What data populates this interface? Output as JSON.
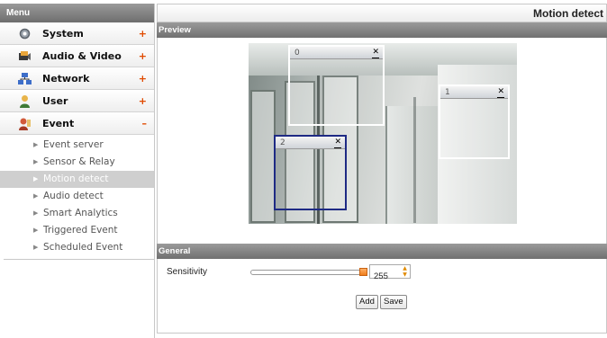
{
  "sidebar": {
    "header": "Menu",
    "items": [
      {
        "label": "System",
        "toggle": "+",
        "icon": "gear-icon"
      },
      {
        "label": "Audio & Video",
        "toggle": "+",
        "icon": "camera-icon"
      },
      {
        "label": "Network",
        "toggle": "+",
        "icon": "network-icon"
      },
      {
        "label": "User",
        "toggle": "+",
        "icon": "user-icon"
      },
      {
        "label": "Event",
        "toggle": "–",
        "icon": "event-icon"
      }
    ],
    "submenu": [
      {
        "label": "Event server",
        "active": false
      },
      {
        "label": "Sensor & Relay",
        "active": false
      },
      {
        "label": "Motion detect",
        "active": true
      },
      {
        "label": "Audio detect",
        "active": false
      },
      {
        "label": "Smart Analytics",
        "active": false
      },
      {
        "label": "Triggered Event",
        "active": false
      },
      {
        "label": "Scheduled Event",
        "active": false
      }
    ]
  },
  "page": {
    "title": "Motion detect"
  },
  "preview": {
    "section_title": "Preview",
    "windows": [
      {
        "number": "0",
        "close": "✕",
        "selected": false
      },
      {
        "number": "1",
        "close": "✕",
        "selected": false
      },
      {
        "number": "2",
        "close": "✕",
        "selected": true
      }
    ]
  },
  "general": {
    "section_title": "General",
    "sensitivity_label": "Sensitivity",
    "sensitivity_value": "255",
    "add_label": "Add",
    "save_label": "Save"
  },
  "colors": {
    "accent": "#ef7d1a",
    "selected_window": "#1e2a84",
    "header_gray": "#7a7a7a"
  }
}
